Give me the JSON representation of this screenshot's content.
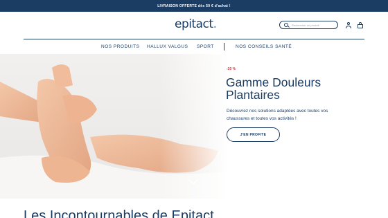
{
  "topbar": {
    "text": "LIVRAISON OFFERTE dès 50 € d'achat !"
  },
  "header": {
    "logo_text": "epitact",
    "logo_dot": ".",
    "search_placeholder": "Rechercher un produit"
  },
  "nav": {
    "items": [
      "NOS PRODUITS",
      "HALLUX VALGUS",
      "SPORT",
      "NOS CONSEILS SANTÉ"
    ]
  },
  "hero": {
    "badge": "-20 %",
    "title": "Gamme Douleurs Plantaires",
    "description": "Découvrez nos solutions adaptées avec toutes vos chaussures et toutes vos activités !",
    "cta_label": "J'EN PROFITE"
  },
  "section": {
    "title": "Les Incontournables de Epitact"
  },
  "colors": {
    "navy": "#1b3d64",
    "accent": "#3e8bc8",
    "promo": "#d9343a"
  }
}
